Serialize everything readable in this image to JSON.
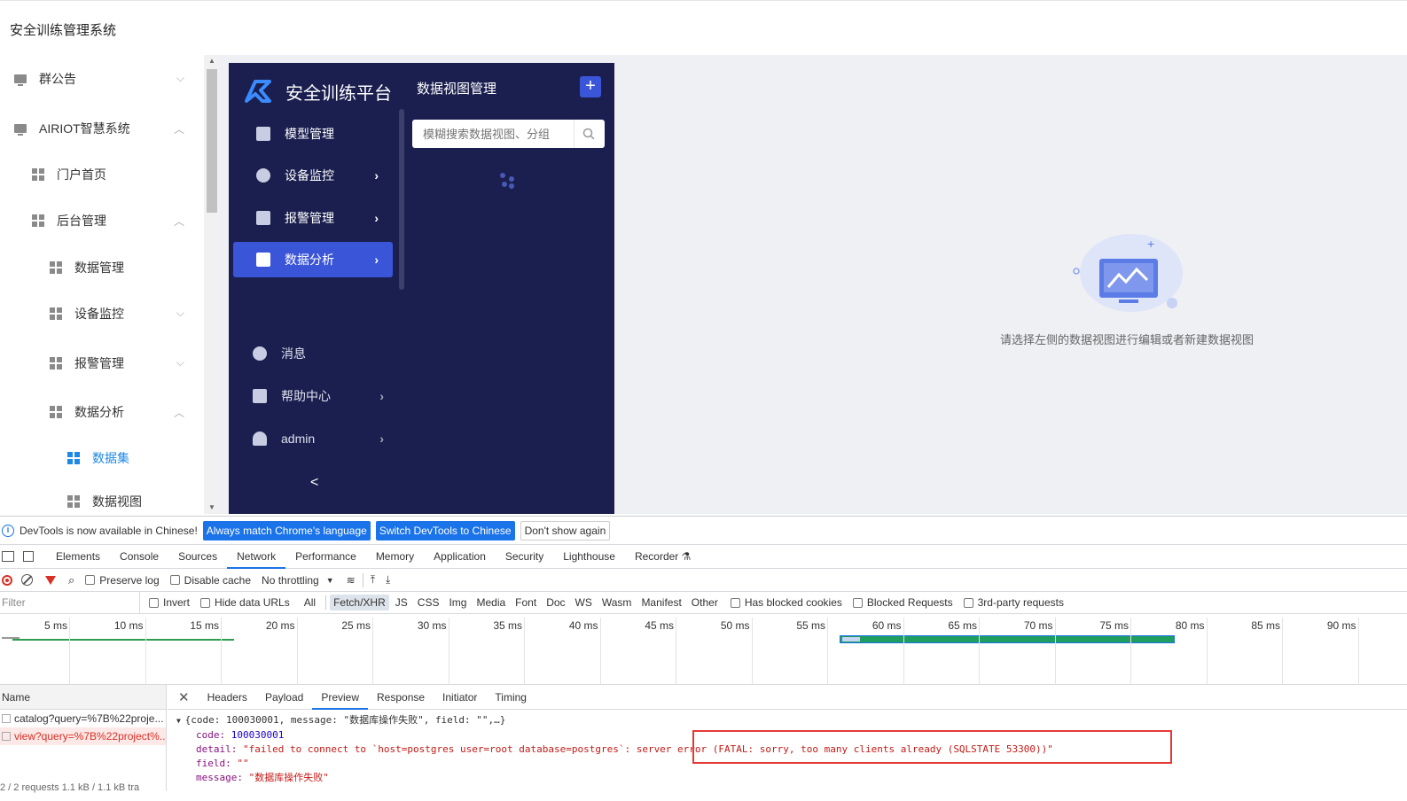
{
  "app": {
    "title": "安全训练管理系统"
  },
  "tree": {
    "items": [
      {
        "label": "群公告",
        "arrow": "⌵"
      },
      {
        "label": "AIRIOT智慧系统",
        "arrow": "︿"
      },
      {
        "label": "门户首页"
      },
      {
        "label": "后台管理",
        "arrow": "︿"
      },
      {
        "label": "数据管理"
      },
      {
        "label": "设备监控",
        "arrow": "⌵"
      },
      {
        "label": "报警管理",
        "arrow": "⌵"
      },
      {
        "label": "数据分析",
        "arrow": "︿"
      },
      {
        "label": "数据集"
      },
      {
        "label": "数据视图"
      }
    ]
  },
  "platform": {
    "brand": "安全训练平台",
    "nav": [
      {
        "label": "模型管理"
      },
      {
        "label": "设备监控",
        "chev": "›"
      },
      {
        "label": "报警管理",
        "chev": "›"
      },
      {
        "label": "数据分析",
        "chev": "›"
      },
      {
        "label": "消息"
      },
      {
        "label": "帮助中心",
        "chev": "›"
      },
      {
        "label": "admin",
        "chev": "›"
      }
    ],
    "collapse": "<",
    "panel_title": "数据视图管理",
    "add_button": "+",
    "search_placeholder": "模糊搜索数据视图、分组",
    "empty_text": "请选择左侧的数据视图进行编辑或者新建数据视图"
  },
  "devtools": {
    "notice": {
      "text": "DevTools is now available in Chinese!",
      "btn1": "Always match Chrome's language",
      "btn2": "Switch DevTools to Chinese",
      "btn3": "Don't show again"
    },
    "tabs": [
      "Elements",
      "Console",
      "Sources",
      "Network",
      "Performance",
      "Memory",
      "Application",
      "Security",
      "Lighthouse",
      "Recorder ⚗"
    ],
    "toolbar": {
      "preserve_log": "Preserve log",
      "disable_cache": "Disable cache",
      "throttling": "No throttling"
    },
    "filter_placeholder": "Filter",
    "filter_opts": {
      "invert": "Invert",
      "hide_data": "Hide data URLs",
      "all": "All"
    },
    "types": [
      "Fetch/XHR",
      "JS",
      "CSS",
      "Img",
      "Media",
      "Font",
      "Doc",
      "WS",
      "Wasm",
      "Manifest",
      "Other"
    ],
    "checks": [
      "Has blocked cookies",
      "Blocked Requests",
      "3rd-party requests"
    ],
    "ticks": [
      "5 ms",
      "10 ms",
      "15 ms",
      "20 ms",
      "25 ms",
      "30 ms",
      "35 ms",
      "40 ms",
      "45 ms",
      "50 ms",
      "55 ms",
      "60 ms",
      "65 ms",
      "70 ms",
      "75 ms",
      "80 ms",
      "85 ms",
      "90 ms"
    ],
    "name_header": "Name",
    "requests": [
      {
        "name": "catalog?query=%7B%22proje...",
        "error": false
      },
      {
        "name": "view?query=%7B%22project%...",
        "error": true
      }
    ],
    "footer": "2 / 2 requests   1.1 kB / 1.1 kB tra",
    "detail_tabs": [
      "Headers",
      "Payload",
      "Preview",
      "Response",
      "Initiator",
      "Timing"
    ],
    "preview": {
      "summary": "{code: 100030001, message: \"数据库操作失败\", field: \"\",…}",
      "code_key": "code:",
      "code_val": "100030001",
      "detail_key": "detail:",
      "detail_val": "\"failed to connect to `host=postgres user=root database=postgres`: server error (FATAL: sorry, too many clients already (SQLSTATE 53300))\"",
      "field_key": "field:",
      "field_val": "\"\"",
      "message_key": "message:",
      "message_val": "\"数据库操作失败\""
    }
  }
}
